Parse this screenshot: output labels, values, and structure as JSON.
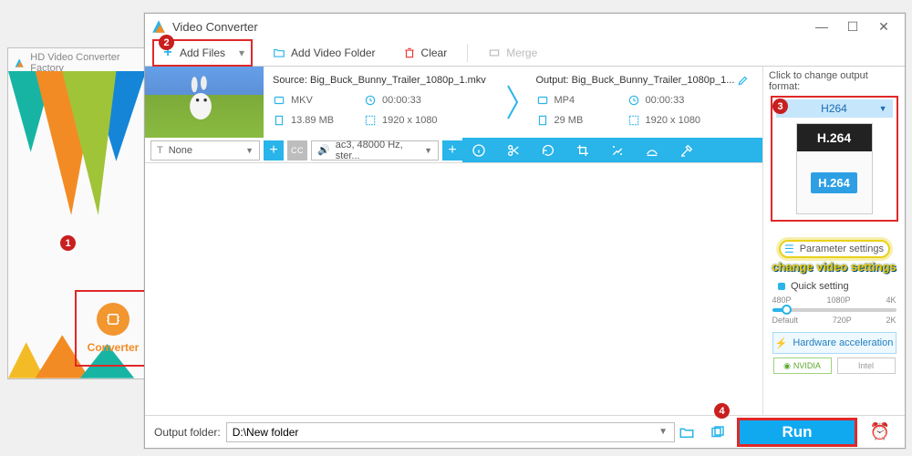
{
  "secondary_window": {
    "title": "HD Video Converter Factory",
    "converter_label": "Converter"
  },
  "badges": {
    "one": "1",
    "two": "2",
    "three": "3",
    "four": "4"
  },
  "window": {
    "title": "Video Converter"
  },
  "toolbar": {
    "add_files": "Add Files",
    "add_folder": "Add Video Folder",
    "clear": "Clear",
    "merge": "Merge"
  },
  "item": {
    "source_label": "Source:",
    "source_name": "Big_Buck_Bunny_Trailer_1080p_1.mkv",
    "output_label": "Output:",
    "output_name": "Big_Buck_Bunny_Trailer_1080p_1...",
    "in_format": "MKV",
    "in_duration": "00:00:33",
    "in_size": "13.89 MB",
    "in_res": "1920 x 1080",
    "out_format": "MP4",
    "out_duration": "00:00:33",
    "out_size": "29 MB",
    "out_res": "1920 x 1080",
    "subtitle": "None",
    "audio": "ac3, 48000 Hz, ster..."
  },
  "side": {
    "click_hint": "Click to change output format:",
    "format_head": "H264",
    "format_big": "H.264",
    "format_chip": "H.264",
    "param": "Parameter settings",
    "change_text": "change video settings",
    "quick": "Quick setting",
    "q_top": {
      "l": "480P",
      "c": "1080P",
      "r": "4K"
    },
    "q_bot": {
      "l": "Default",
      "c": "720P",
      "r": "2K"
    },
    "hwa": "Hardware acceleration",
    "nvidia": "NVIDIA",
    "intel": "Intel"
  },
  "bottom": {
    "output_label": "Output folder:",
    "output_path": "D:\\New folder",
    "run": "Run"
  }
}
